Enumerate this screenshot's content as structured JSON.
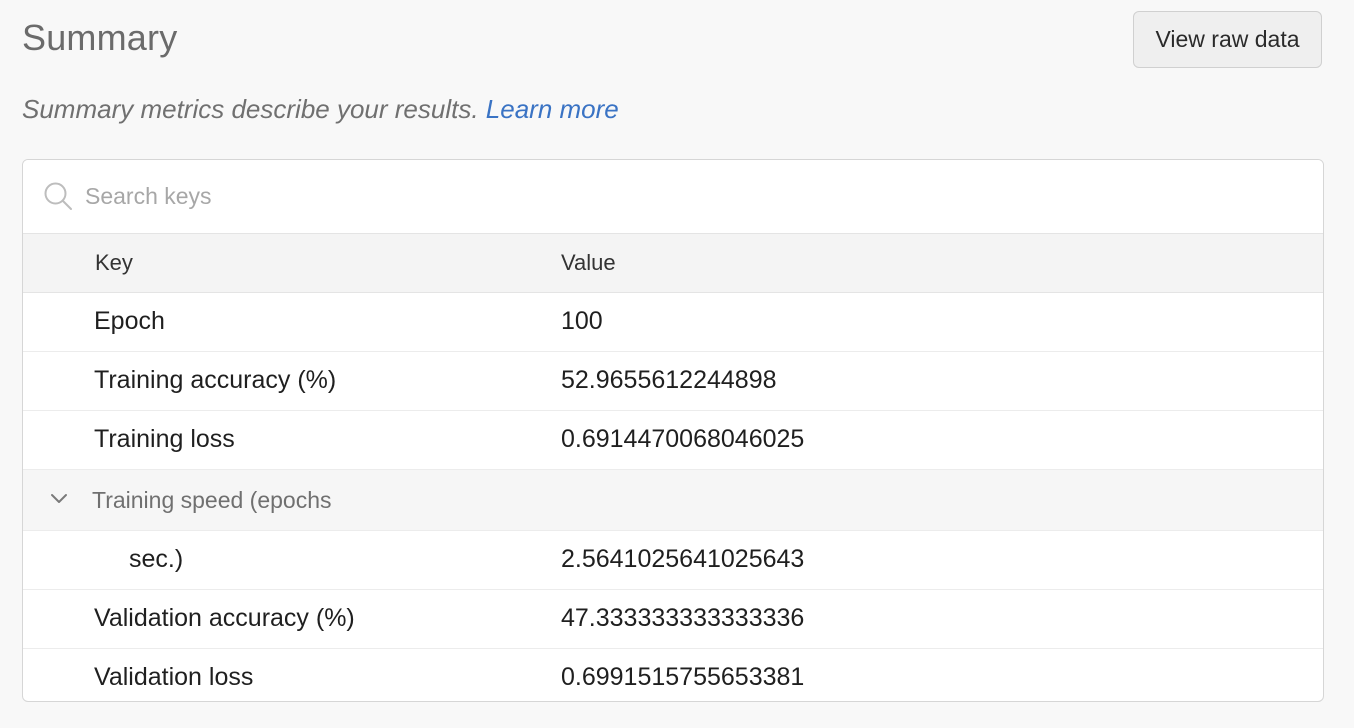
{
  "header": {
    "title": "Summary",
    "view_raw_label": "View raw data"
  },
  "description": {
    "text": "Summary metrics describe your results.",
    "link_label": "Learn more"
  },
  "search": {
    "placeholder": "Search keys",
    "value": ""
  },
  "table": {
    "columns": [
      "Key",
      "Value"
    ],
    "rows": [
      {
        "key": "Epoch",
        "value": "100"
      },
      {
        "key": "Training accuracy (%)",
        "value": "52.9655612244898"
      },
      {
        "key": "Training loss",
        "value": "0.6914470068046025"
      }
    ],
    "group": {
      "label": "Training speed (epochs",
      "expanded": true,
      "children": [
        {
          "key": "sec.)",
          "value": "2.5641025641025643"
        }
      ]
    },
    "rows_after": [
      {
        "key": "Validation accuracy (%)",
        "value": "47.333333333333336"
      },
      {
        "key": "Validation loss",
        "value": "0.6991515755653381"
      }
    ]
  },
  "icons": {
    "search": "search-icon",
    "expand": "chevron-down-icon"
  },
  "colors": {
    "link": "#3a73c4",
    "background": "#f8f8f8"
  }
}
